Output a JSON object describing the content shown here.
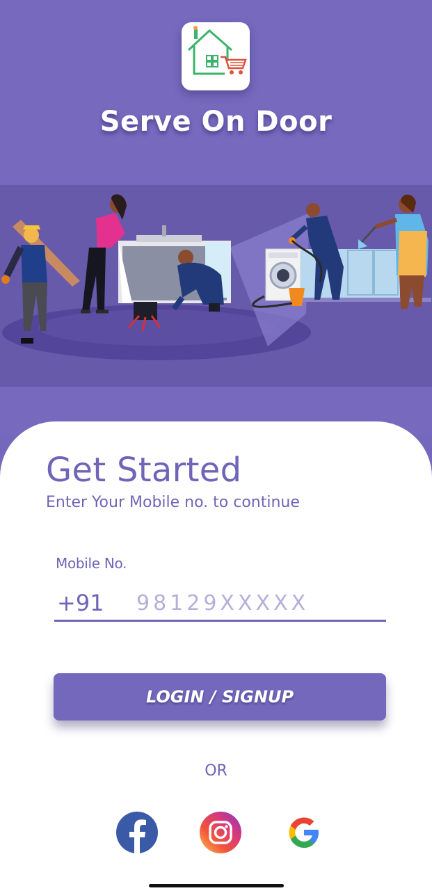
{
  "app": {
    "title": "Serve On Door",
    "logo_icon": "house-cart-logo"
  },
  "hero": {
    "illustration": "home-services-illustration"
  },
  "auth": {
    "heading": "Get Started",
    "subtitle": "Enter Your Mobile no. to continue",
    "mobile_label": "Mobile No.",
    "country_code": "+91",
    "mobile_placeholder": "98129XXXXX",
    "mobile_value": "",
    "login_button": "LOGIN / SIGNUP",
    "or_text": "OR"
  },
  "social": [
    {
      "name": "facebook",
      "icon": "facebook-icon"
    },
    {
      "name": "instagram",
      "icon": "instagram-icon"
    },
    {
      "name": "google",
      "icon": "google-icon"
    }
  ],
  "colors": {
    "primary": "#7468bd",
    "hero_bg": "#675aab",
    "text_primary": "#6f64b7",
    "placeholder": "#b5afdc",
    "logo_green": "#3bb36a",
    "logo_red": "#e0503a"
  }
}
